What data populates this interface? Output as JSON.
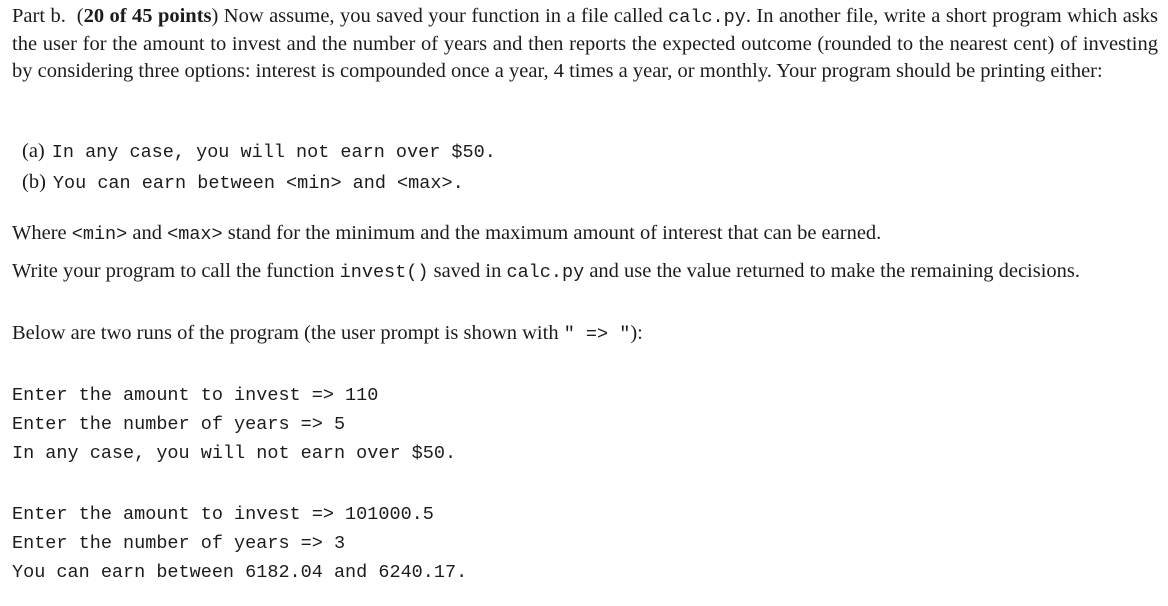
{
  "intro": {
    "part_label": "Part b.",
    "points_open": "(",
    "points_bold": "20 of 45 points",
    "points_close": ")",
    "text_1": " Now assume, you saved your function in a file called ",
    "file_code": "calc.py",
    "text_2": ". In another file, write a short program which asks the user for the amount to invest and the number of years and then reports the expected outcome (rounded to the nearest cent) of investing by considering three options: interest is compounded once a year, 4 times a year, or monthly. Your program should be printing either:"
  },
  "options": [
    {
      "label": "(a)",
      "code": "In any case, you will not earn over $50."
    },
    {
      "label": "(b)",
      "code": "You can earn between <min> and <max>."
    }
  ],
  "where": {
    "text_1": "Where ",
    "min_code": "<min>",
    "text_2": " and ",
    "max_code": "<max>",
    "text_3": " stand for the minimum and the maximum amount of interest that can be earned."
  },
  "write": {
    "text_1": "Write your program to call the function ",
    "func_code": "invest()",
    "text_2": " saved in ",
    "file_code": "calc.py",
    "text_3": " and use the value returned to make the remaining decisions."
  },
  "below": {
    "text_1": "Below are two runs of the program (the user prompt is shown with ",
    "prompt_code": "\" => \"",
    "text_2": "):"
  },
  "runs": [
    {
      "lines": [
        "Enter the amount to invest => 110",
        "Enter the number of years => 5",
        "In any case, you will not earn over $50."
      ]
    },
    {
      "lines": [
        "Enter the amount to invest => 101000.5",
        "Enter the number of years => 3",
        "You can earn between 6182.04 and 6240.17."
      ]
    }
  ]
}
